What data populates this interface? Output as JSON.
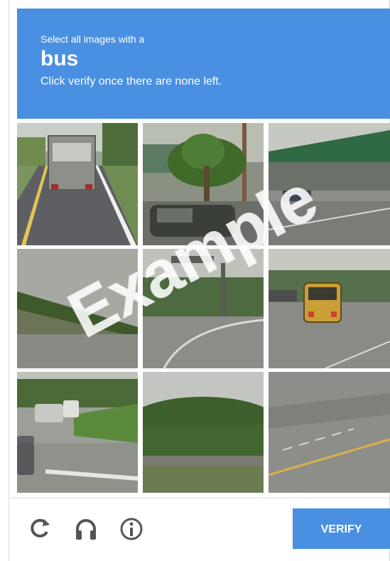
{
  "header": {
    "instruction": "Select all images with a",
    "target_word": "bus",
    "note": "Click verify once there are none left."
  },
  "grid": {
    "rows": 3,
    "columns": 3
  },
  "watermark": {
    "text": "Example"
  },
  "footer": {
    "icons": [
      "reload-icon",
      "audio-headphones-icon",
      "info-icon"
    ],
    "verify_label": "VERIFY"
  },
  "colors": {
    "accent": "#4a90e2",
    "watermark": "#ffffff"
  }
}
